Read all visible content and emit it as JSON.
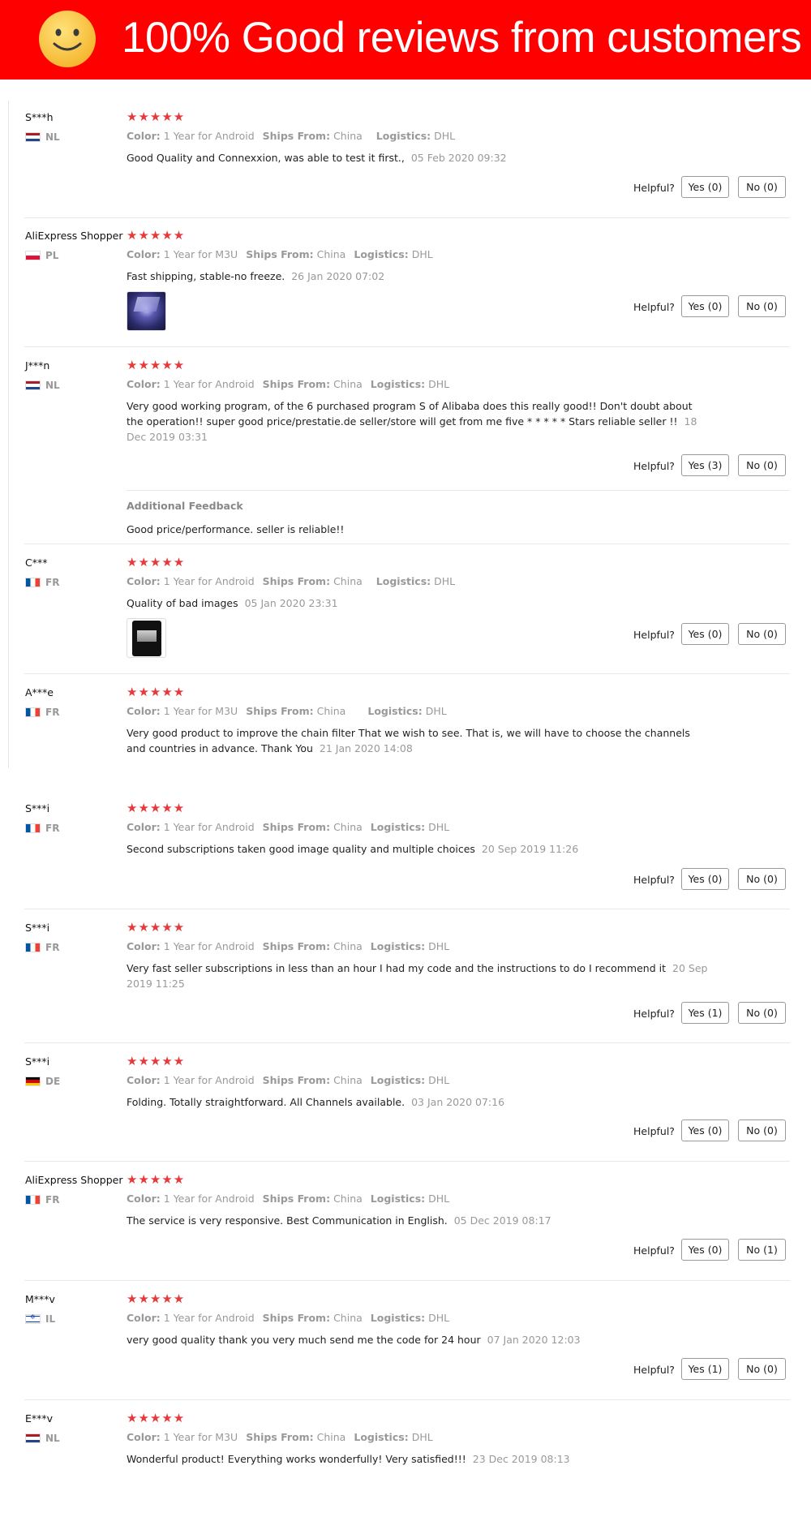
{
  "banner": {
    "title": "100% Good reviews from customers",
    "background": "#ff0000",
    "icon": "smiley-icon"
  },
  "labels": {
    "color": "Color:",
    "ships_from": "Ships From:",
    "logistics": "Logistics:",
    "helpful": "Helpful?",
    "additional_feedback": "Additional Feedback"
  },
  "star_color": "#e6393b",
  "rating_stars": "★★★★★",
  "reviews": [
    {
      "user": "S***h",
      "country": "NL",
      "rating": 5,
      "color": "1 Year for Android",
      "ships_from": "China",
      "logistics": "DHL",
      "text": "Good Quality and Connexxion, was able to test it first.,",
      "date": "05 Feb 2020 09:32",
      "yes": "Yes (0)",
      "no": "No (0)"
    },
    {
      "user": "AliExpress Shopper",
      "country": "PL",
      "rating": 5,
      "color": "1 Year for M3U",
      "ships_from": "China",
      "logistics": "DHL",
      "text": "Fast shipping, stable-no freeze.",
      "date": "26 Jan 2020 07:02",
      "yes": "Yes (0)",
      "no": "No (0)",
      "has_image": true
    },
    {
      "user": "J***n",
      "country": "NL",
      "rating": 5,
      "color": "1 Year for Android",
      "ships_from": "China",
      "logistics": "DHL",
      "text": "Very good working program, of the 6 purchased program S of Alibaba does this really good!! Don't doubt about the operation!! super good price/prestatie.de seller/store will get from me five * * * * * Stars reliable seller !!",
      "date": "18 Dec 2019 03:31",
      "yes": "Yes (3)",
      "no": "No (0)",
      "additional_feedback": "Good price/performance. seller is reliable!!"
    },
    {
      "user": "C***",
      "country": "FR",
      "rating": 5,
      "color": "1 Year for Android",
      "ships_from": "China",
      "logistics": "DHL",
      "text": "Quality of bad images",
      "date": "05 Jan 2020 23:31",
      "yes": "Yes (0)",
      "no": "No (0)",
      "has_image": true
    },
    {
      "user": "A***e",
      "country": "FR",
      "rating": 5,
      "color": "1 Year for M3U",
      "ships_from": "China",
      "logistics": "DHL",
      "text": "Very good product to improve the chain filter That we wish to see. That is, we will have to choose the channels and countries in advance. Thank You",
      "date": "21 Jan 2020 14:08"
    },
    {
      "user": "S***i",
      "country": "FR",
      "rating": 5,
      "color": "1 Year for Android",
      "ships_from": "China",
      "logistics": "DHL",
      "text": "Second subscriptions taken good image quality and multiple choices",
      "date": "20 Sep 2019 11:26",
      "yes": "Yes (0)",
      "no": "No (0)"
    },
    {
      "user": "S***i",
      "country": "FR",
      "rating": 5,
      "color": "1 Year for Android",
      "ships_from": "China",
      "logistics": "DHL",
      "text": "Very fast seller subscriptions in less than an hour I had my code and the instructions to do I recommend it",
      "date": "20 Sep 2019 11:25",
      "yes": "Yes (1)",
      "no": "No (0)"
    },
    {
      "user": "S***i",
      "country": "DE",
      "rating": 5,
      "color": "1 Year for Android",
      "ships_from": "China",
      "logistics": "DHL",
      "text": "Folding. Totally straightforward. All Channels available.",
      "date": "03 Jan 2020 07:16",
      "yes": "Yes (0)",
      "no": "No (0)"
    },
    {
      "user": "AliExpress Shopper",
      "country": "FR",
      "rating": 5,
      "color": "1 Year for Android",
      "ships_from": "China",
      "logistics": "DHL",
      "text": "The service is very responsive. Best Communication in English.",
      "date": "05 Dec 2019 08:17",
      "yes": "Yes (0)",
      "no": "No (1)"
    },
    {
      "user": "M***v",
      "country": "IL",
      "rating": 5,
      "color": "1 Year for Android",
      "ships_from": "China",
      "logistics": "DHL",
      "text": "very good quality thank you very much send me the code for 24 hour",
      "date": "07 Jan 2020 12:03",
      "yes": "Yes (1)",
      "no": "No (0)"
    },
    {
      "user": "E***v",
      "country": "NL",
      "rating": 5,
      "color": "1 Year for M3U",
      "ships_from": "China",
      "logistics": "DHL",
      "text": "Wonderful product! Everything works wonderfully! Very satisfied!!!",
      "date": "23 Dec 2019 08:13"
    }
  ]
}
